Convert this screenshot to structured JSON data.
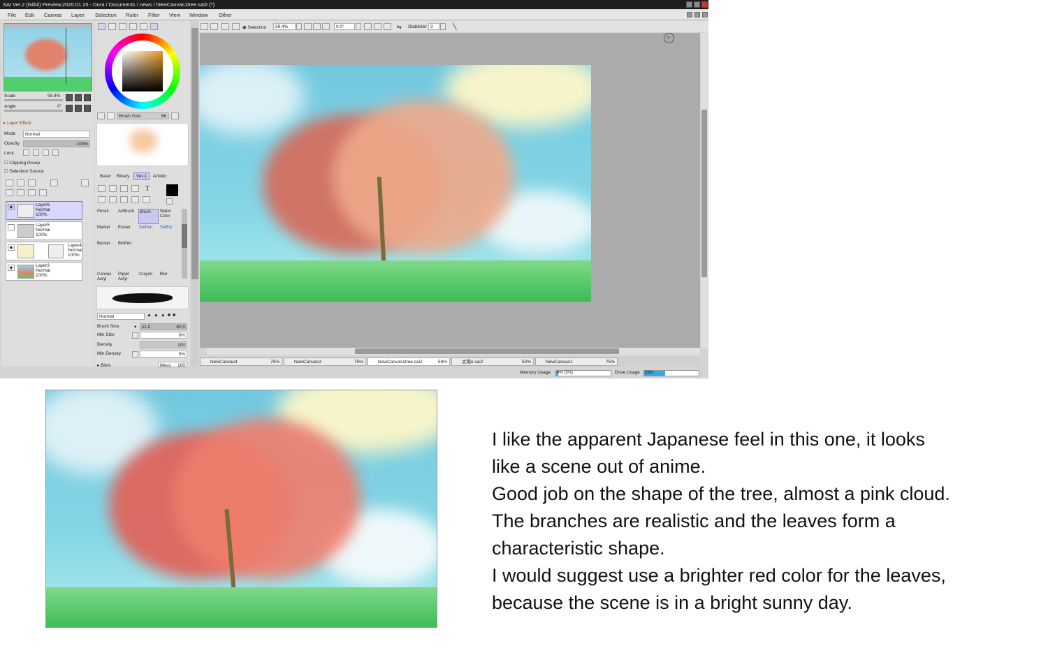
{
  "window": {
    "title": "SAI Ver.2 (64bit) Preview.2020.01.25 - Dora / Documents / news / NewCanvas1tree.sai2 (*)"
  },
  "menu": [
    "File",
    "Edit",
    "Canvas",
    "Layer",
    "Selection",
    "Ruler",
    "Filter",
    "View",
    "Window",
    "Other"
  ],
  "navigator": {
    "scale_label": "Scale",
    "scale_value": "59.4%",
    "angle_label": "Angle",
    "angle_value": "0°"
  },
  "layer_effect": {
    "header": "Layer Effect",
    "mode_label": "Mode",
    "mode_value": "Normal",
    "opacity_label": "Opacity",
    "opacity_value": "100%",
    "lock_label": "Lock",
    "clipping_label": "Clipping Group",
    "selection_source_label": "Selection Source"
  },
  "layers": [
    {
      "name": "Layer6",
      "mode": "Normal",
      "opacity": "100%"
    },
    {
      "name": "Layer5",
      "mode": "Normal",
      "opacity": "100%"
    },
    {
      "name": "Layer4",
      "mode": "Normal",
      "opacity": "100%"
    },
    {
      "name": "Layer3",
      "mode": "Normal",
      "opacity": "100%"
    }
  ],
  "brush_preview": {
    "label": "Brush Size",
    "value": "56"
  },
  "tool_tabs": [
    "Basic",
    "Binary",
    "Ver.1",
    "Artistic"
  ],
  "tools": [
    [
      "Pencil",
      "AirBrush",
      "Brush",
      "Water Color"
    ],
    [
      "Marker",
      "Eraser",
      "SelPen",
      "SelErs"
    ],
    [
      "Bucket",
      "BinPen",
      "",
      ""
    ],
    [
      "Canvas Acryl",
      "Paper Acryl",
      "Crayon",
      "Blur"
    ]
  ],
  "brush_settings": {
    "mode_value": "Normal",
    "brush_size_label": "Brush Size",
    "brush_size_mult": "x1.0",
    "brush_size_value": "60.0",
    "min_size_label": "Min Size",
    "min_size_value": "0%",
    "density_label": "Density",
    "density_value": "100",
    "min_density_label": "Min Density",
    "min_density_value": "0%",
    "blots_label": "Blots",
    "mess_label": "Mess",
    "mess_value": "100"
  },
  "canvas_toolbar": {
    "selection_label": "Selection",
    "zoom_value": "59.4%",
    "angle_value": "0.0°",
    "stabilizer_label": "Stabilizer",
    "stabilizer_value": "3"
  },
  "doc_tabs": [
    {
      "name": "NewCanvas4",
      "pct": "75%"
    },
    {
      "name": "NewCanvas3",
      "pct": "75%"
    },
    {
      "name": "NewCanvas1tree.sai2",
      "pct": "59%"
    },
    {
      "name": "太陽e.sai2",
      "pct": "50%"
    },
    {
      "name": "NewCanvas1",
      "pct": "75%"
    }
  ],
  "statusbar": {
    "memory_label": "Memory Usage",
    "memory_value": "4% (5%)",
    "memory_fill": 0.04,
    "drive_label": "Drive Usage",
    "drive_value": "39%",
    "drive_fill": 0.39
  },
  "comment": [
    "I like the apparent Japanese feel in this one, it looks",
    "like a scene out of anime.",
    "Good job on the shape of the tree, almost a pink cloud.",
    "The branches are realistic and the leaves form a",
    "characteristic shape.",
    "I would suggest use a brighter red color for the leaves,",
    "because the scene is in a bright sunny day."
  ],
  "colors": {
    "accent": "#2ea8e6",
    "selection": "#c9c9ee",
    "canvas_bg": "#ababab",
    "tree_pink": "#e78a72",
    "grass": "#46c86a",
    "sky": "#7fd3e4"
  }
}
